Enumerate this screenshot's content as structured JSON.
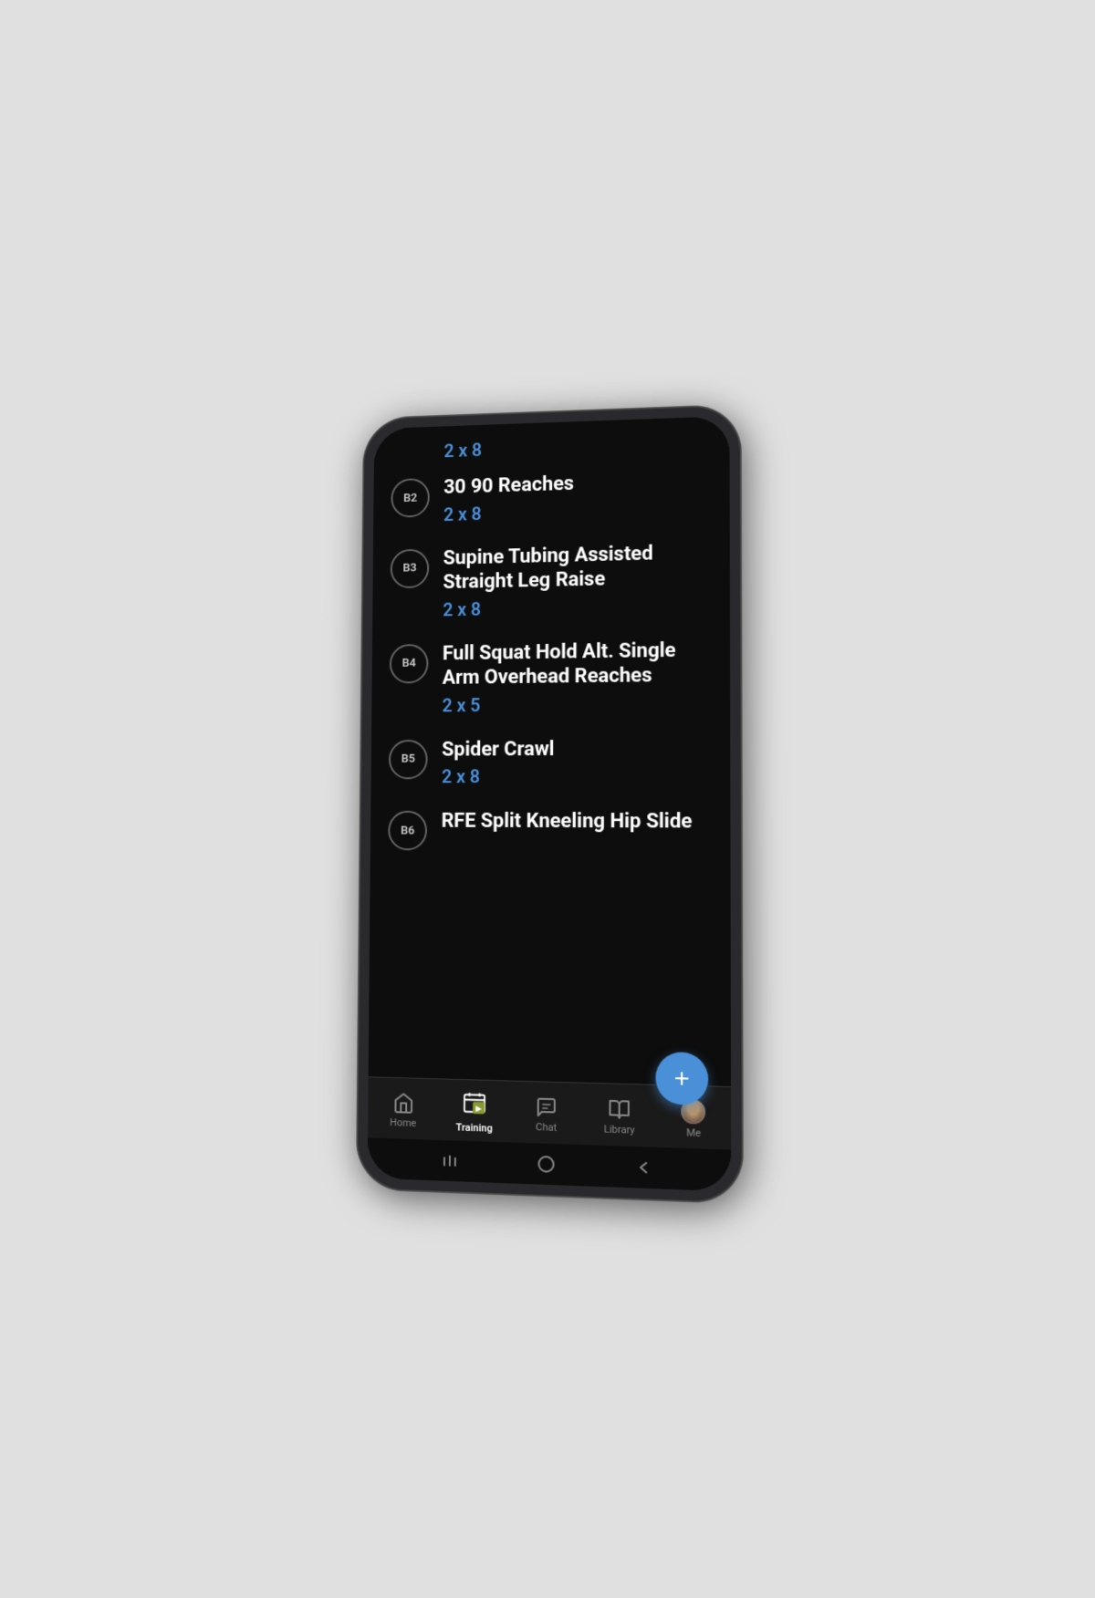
{
  "phone": {
    "partial_top": {
      "sets": "2 x 8"
    },
    "exercises": [
      {
        "id": "b2",
        "badge": "B2",
        "name": "30 90 Reaches",
        "sets": "2 x 8"
      },
      {
        "id": "b3",
        "badge": "B3",
        "name": "Supine Tubing Assisted Straight Leg Raise",
        "sets": "2 x 8"
      },
      {
        "id": "b4",
        "badge": "B4",
        "name": "Full Squat Hold Alt. Single Arm Overhead Reaches",
        "sets": "2 x 5"
      },
      {
        "id": "b5",
        "badge": "B5",
        "name": "Spider Crawl",
        "sets": "2 x 8"
      },
      {
        "id": "b6",
        "badge": "B6",
        "name": "RFE Split Kneeling Hip Slide",
        "sets": ""
      }
    ],
    "fab": {
      "label": "+"
    },
    "nav": {
      "items": [
        {
          "id": "home",
          "label": "Home",
          "active": false
        },
        {
          "id": "training",
          "label": "Training",
          "active": true
        },
        {
          "id": "chat",
          "label": "Chat",
          "active": false
        },
        {
          "id": "library",
          "label": "Library",
          "active": false
        },
        {
          "id": "me",
          "label": "Me",
          "active": false
        }
      ]
    },
    "colors": {
      "accent": "#4a90d9",
      "background": "#0d0d0d",
      "text_primary": "#ffffff",
      "text_secondary": "#cccccc",
      "badge_border": "#666666"
    }
  }
}
